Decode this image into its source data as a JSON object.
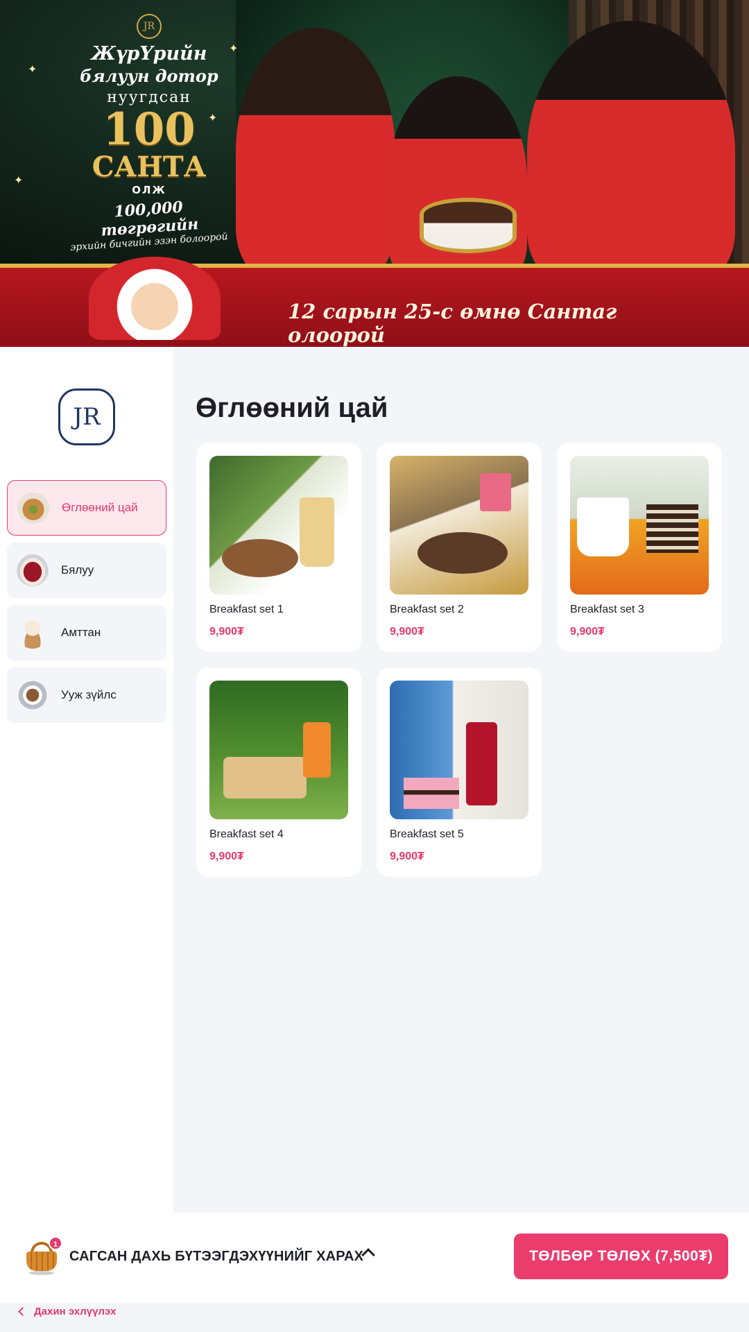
{
  "banner": {
    "logo_text": "JR",
    "promo_line1": "ЖүрҮрийн",
    "promo_line2": "бялуун дотор",
    "promo_line3": "нуугдсан",
    "promo_big": "100",
    "promo_santa": "САНТА",
    "promo_olj": "ОЛЖ",
    "promo_amount": "100,000 төгрөгийн",
    "promo_sub": "эрхийн бичгийн эзэн болоорой",
    "ribbon_text": "12 сарын 25-с өмнө Сантаг олоорой"
  },
  "sidebar": {
    "logo_text": "JR",
    "categories": [
      {
        "label": "Өглөөний цай",
        "icon": "sandwich-icon",
        "active": true
      },
      {
        "label": "Бялуу",
        "icon": "cake-icon",
        "active": false
      },
      {
        "label": "Амттан",
        "icon": "cupcake-icon",
        "active": false
      },
      {
        "label": "Ууж зүйлс",
        "icon": "coffee-icon",
        "active": false
      }
    ]
  },
  "main": {
    "title": "Өглөөний цай",
    "products": [
      {
        "name": "Breakfast set 1",
        "price": "9,900₮"
      },
      {
        "name": "Breakfast set 2",
        "price": "9,900₮"
      },
      {
        "name": "Breakfast set 3",
        "price": "9,900₮"
      },
      {
        "name": "Breakfast set 4",
        "price": "9,900₮"
      },
      {
        "name": "Breakfast set 5",
        "price": "9,900₮"
      }
    ]
  },
  "cart": {
    "count": "1",
    "label": "САГСАН ДАХЬ БҮТЭЭГДЭХҮҮНИЙГ ХАРАХ",
    "pay_label": "ТӨЛБӨР ТӨЛӨХ (7,500₮)",
    "restart_label": "Дахин эхлүүлэх"
  },
  "colors": {
    "accent": "#e43a6e",
    "active_bg": "#fde8ee",
    "page_bg": "#f4f5f9"
  }
}
